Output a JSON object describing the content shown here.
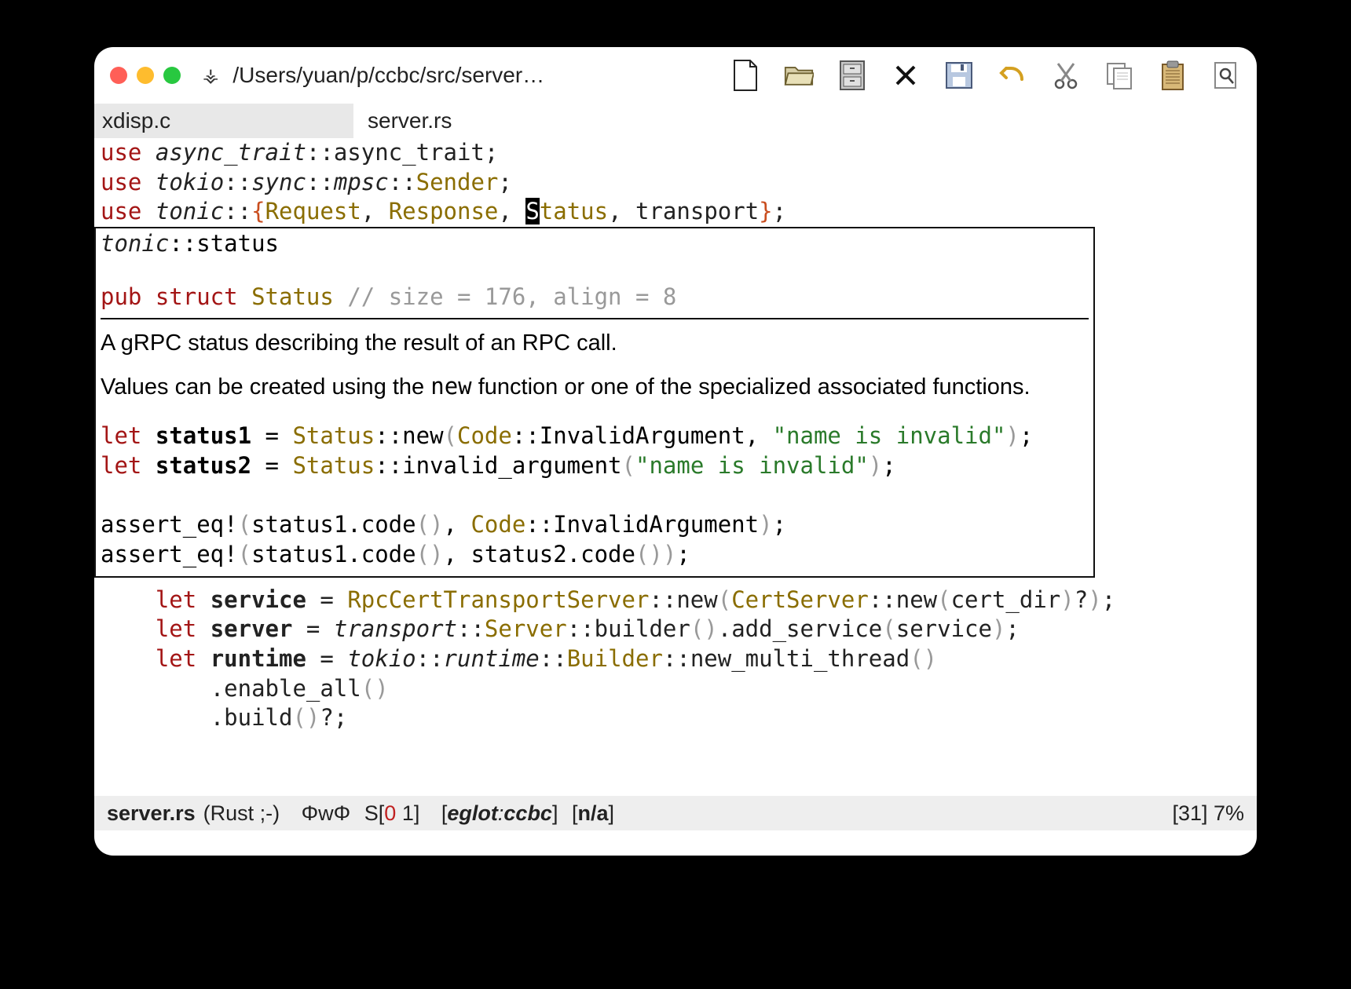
{
  "titlebar": {
    "path": "/Users/yuan/p/ccbc/src/server…",
    "vc_glyph": "⚶"
  },
  "tabs": [
    {
      "label": "xdisp.c",
      "active": true
    },
    {
      "label": "server.rs",
      "active": false
    }
  ],
  "code": {
    "l1": {
      "kw": "use",
      "p1": "async_trait",
      "p2": "::async_trait;"
    },
    "l2": {
      "kw": "use",
      "p1": "tokio",
      "p2": "::",
      "p3": "sync",
      "p4": "::",
      "p5": "mpsc",
      "p6": "::",
      "t": "Sender",
      "end": ";"
    },
    "l3": {
      "kw": "use",
      "p1": "tonic",
      "p2": "::",
      "ob": "{",
      "a": "Request",
      "c1": ", ",
      "b": "Response",
      "c2": ", ",
      "cur": "S",
      "rest": "tatus",
      "c3": ", ",
      "d": "transport",
      "cb": "}",
      "end": ";"
    }
  },
  "popup": {
    "sig_path": "tonic",
    "sig_rest": "::status",
    "sig2_kw": "pub struct",
    "sig2_name": "Status",
    "sig2_comment": "// size = 176, align = 8",
    "doc1": "A gRPC status describing the result of an RPC call.",
    "doc2a": "Values can be created using the ",
    "doc2code": "new",
    "doc2b": " function or one of the specialized associated functions.",
    "s1": {
      "kw": "let",
      "v": "status1",
      "eq": " = ",
      "t": "Status",
      "m": "::new",
      "op": "(",
      "t2": "Code",
      "m2": "::InvalidArgument",
      "c": ", ",
      "str": "\"name is invalid\"",
      "cp": ")",
      "end": ";"
    },
    "s2": {
      "kw": "let",
      "v": "status2",
      "eq": " = ",
      "t": "Status",
      "m": "::invalid_argument",
      "op": "(",
      "str": "\"name is invalid\"",
      "cp": ")",
      "end": ";"
    },
    "a1": {
      "m": "assert_eq!",
      "op": "(",
      "e1": "status1.code",
      "p1": "()",
      "c": ", ",
      "t": "Code",
      "m2": "::InvalidArgument",
      "cp": ")",
      "end": ";"
    },
    "a2": {
      "m": "assert_eq!",
      "op": "(",
      "e1": "status1.code",
      "p1": "()",
      "c": ", ",
      "e2": "status2.code",
      "p2": "()",
      "cp": ")",
      "end": ";"
    }
  },
  "below": {
    "b1": {
      "pad": "    ",
      "kw": "let",
      "v": "service",
      "eq": " = ",
      "t": "RpcCertTransportServer",
      "m": "::new",
      "op": "(",
      "t2": "CertServer",
      "m2": "::new",
      "op2": "(",
      "arg": "cert_dir",
      "cp2": ")",
      "q": "?",
      "cp": ")",
      "end": ";"
    },
    "b2": {
      "pad": "    ",
      "kw": "let",
      "v": "server",
      "eq": " = ",
      "p": "transport",
      "m": "::",
      "t": "Server",
      "m2": "::builder",
      "op": "()",
      "m3": ".add_service",
      "op2": "(",
      "arg": "service",
      "cp2": ")",
      "end": ";"
    },
    "b3": {
      "pad": "    ",
      "kw": "let",
      "v": "runtime",
      "eq": " = ",
      "p": "tokio",
      "m": "::",
      "p2": "runtime",
      "m2": "::",
      "t": "Builder",
      "m3": "::new_multi_thread",
      "op": "()"
    },
    "b4": {
      "pad": "        ",
      "m": ".enable_all",
      "op": "()"
    },
    "b5": {
      "pad": "        ",
      "m": ".build",
      "op": "()",
      "q": "?;"
    }
  },
  "modeline": {
    "filename": "server.rs",
    "mode": "(Rust ;-)",
    "flycheck": "ΦwΦ",
    "syntax_pre": "S[",
    "syntax_err": "0",
    "syntax_space": " ",
    "syntax_warn": "1",
    "syntax_post": "]",
    "eglot_open": "[",
    "eglot_label": "eglot",
    "eglot_sep": ":",
    "eglot_proj": "ccbc",
    "eglot_close": "]",
    "na": "[n/a]",
    "position": "[31] 7%"
  }
}
